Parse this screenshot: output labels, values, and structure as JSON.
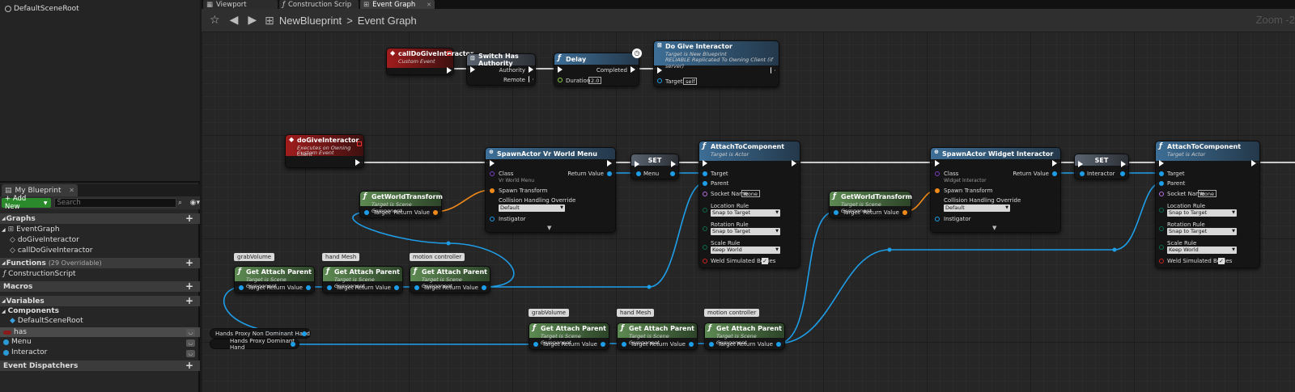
{
  "component_tree": {
    "root": "DefaultSceneRoot"
  },
  "my_blueprint": {
    "tab_label": "My Blueprint",
    "add_new": "+ Add New",
    "search_placeholder": "Search",
    "graphs_header": "Graphs",
    "graphs": [
      "EventGraph",
      "doGiveInteractor",
      "callDoGiveInteractor"
    ],
    "functions_header": "Functions",
    "functions_count": "(29 Overridable)",
    "functions": [
      "ConstructionScript"
    ],
    "macros_header": "Macros",
    "variables_header": "Variables",
    "components_header": "Components",
    "components": [
      "DefaultSceneRoot"
    ],
    "variables": [
      {
        "name": "has",
        "color": "#8b1a1a"
      },
      {
        "name": "Menu",
        "color": "#2a9ad6"
      },
      {
        "name": "Interactor",
        "color": "#2a9ad6"
      }
    ],
    "dispatchers_header": "Event Dispatchers"
  },
  "tabs": [
    "Viewport",
    "Construction Scrip",
    "Event Graph"
  ],
  "breadcrumb": {
    "blueprint": "NewBlueprint",
    "sep": ">",
    "graph": "Event Graph"
  },
  "zoom": "Zoom -2",
  "nodes": {
    "call_event": {
      "title": "callDoGiveInteractor",
      "sub": "Custom Event"
    },
    "switch_auth": {
      "title": "Switch Has Authority",
      "authority": "Authority",
      "remote": "Remote"
    },
    "delay": {
      "title": "Delay",
      "completed": "Completed",
      "duration_label": "Duration",
      "duration_value": "2.0"
    },
    "do_give": {
      "title": "Do Give Interactor",
      "sub1": "Target is New Blueprint",
      "sub2": "RELIABLE Replicated To Owning Client (if server)",
      "target_label": "Target",
      "target_value": "self"
    },
    "do_event": {
      "title": "doGiveInteractor",
      "sub1": "Executes on Owning Client",
      "sub2": "Custom Event"
    },
    "spawn_menu": {
      "title": "SpawnActor Vr World Menu",
      "class_label": "Class",
      "class_value": "Vr World Menu",
      "return_label": "Return Value",
      "spawn_label": "Spawn Transform",
      "collision_label": "Collision Handling Override",
      "collision_value": "Default",
      "instigator_label": "Instigator"
    },
    "set1": {
      "title": "SET",
      "var": "Menu"
    },
    "attach1": {
      "title": "AttachToComponent",
      "sub": "Target is Actor",
      "target": "Target",
      "parent": "Parent",
      "socket_label": "Socket Name",
      "socket_value": "None",
      "loc_label": "Location Rule",
      "loc_value": "Snap to Target",
      "rot_label": "Rotation Rule",
      "rot_value": "Snap to Target",
      "scale_label": "Scale Rule",
      "scale_value": "Keep World",
      "weld_label": "Weld Simulated Bodies"
    },
    "gwt1": {
      "title": "GetWorldTransform",
      "sub": "Target is Scene Component",
      "target": "Target",
      "ret": "Return Value"
    },
    "gwt2": {
      "title": "GetWorldTransform",
      "sub": "Target is Scene Component",
      "target": "Target",
      "ret": "Return Value"
    },
    "spawn_widget": {
      "title": "SpawnActor Widget Interactor",
      "class_label": "Class",
      "class_value": "Widget Interactor",
      "return_label": "Return Value",
      "spawn_label": "Spawn Transform",
      "collision_label": "Collision Handling Override",
      "collision_value": "Default",
      "instigator_label": "Instigator"
    },
    "set2": {
      "title": "SET",
      "var": "Interactor"
    },
    "attach2": {
      "title": "AttachToComponent",
      "sub": "Target is Actor",
      "target": "Target",
      "parent": "Parent",
      "socket_label": "Socket Name",
      "socket_value": "None",
      "loc_label": "Location Rule",
      "loc_value": "Snap to Target",
      "rot_label": "Rotation Rule",
      "rot_value": "Snap to Target",
      "scale_label": "Scale Rule",
      "scale_value": "Keep World",
      "weld_label": "Weld Simulated Bodies"
    },
    "gap": {
      "title": "Get Attach Parent",
      "sub": "Target is Scene Component",
      "target": "Target",
      "ret": "Return Value"
    },
    "comments_top": [
      "grabVolume",
      "hand Mesh",
      "motion controller"
    ],
    "comments_bottom": [
      "grabVolume",
      "hand Mesh",
      "motion controller"
    ],
    "hands_nondominant": "Hands Proxy Non Dominant Hand",
    "hands_dominant": "Hands Proxy Dominant Hand"
  },
  "colors": {
    "exec": "#ffffff",
    "object": "#1e9ee8",
    "transform": "#f08a18",
    "class": "#7a3cc0",
    "bool": "#8a1010"
  }
}
